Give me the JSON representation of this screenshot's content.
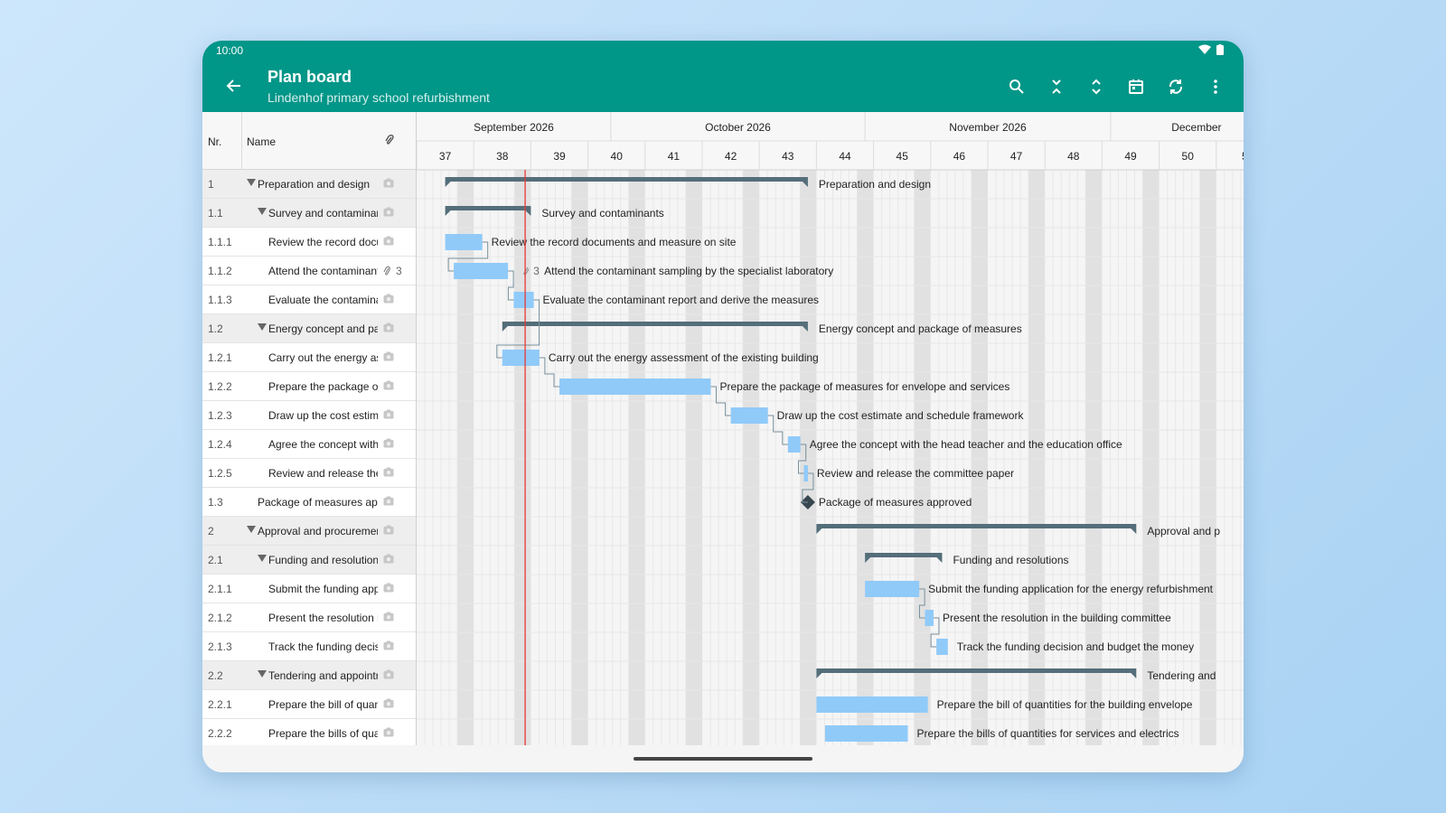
{
  "status": {
    "time": "10:00"
  },
  "app": {
    "title": "Plan board",
    "subtitle": "Lindenhof primary school refurbishment"
  },
  "colors": {
    "accent": "#009688",
    "bar": "#90caf9",
    "summary": "#546e7a",
    "today": "#e53935"
  },
  "table": {
    "header": {
      "nr": "Nr.",
      "name": "Name"
    },
    "rows": [
      {
        "nr": "1",
        "name": "Preparation and design",
        "level": 0,
        "group": true
      },
      {
        "nr": "1.1",
        "name": "Survey and contaminan",
        "level": 1,
        "group": true
      },
      {
        "nr": "1.1.1",
        "name": "Review the record docu",
        "level": 2,
        "group": false
      },
      {
        "nr": "1.1.2",
        "name": "Attend the contaminant",
        "level": 2,
        "group": false,
        "attachments": "3"
      },
      {
        "nr": "1.1.3",
        "name": "Evaluate the contamina",
        "level": 2,
        "group": false
      },
      {
        "nr": "1.2",
        "name": "Energy concept and pa",
        "level": 1,
        "group": true
      },
      {
        "nr": "1.2.1",
        "name": "Carry out the energy as",
        "level": 2,
        "group": false
      },
      {
        "nr": "1.2.2",
        "name": "Prepare the package of",
        "level": 2,
        "group": false
      },
      {
        "nr": "1.2.3",
        "name": "Draw up the cost estim",
        "level": 2,
        "group": false
      },
      {
        "nr": "1.2.4",
        "name": "Agree the concept with",
        "level": 2,
        "group": false
      },
      {
        "nr": "1.2.5",
        "name": "Review and release the",
        "level": 2,
        "group": false
      },
      {
        "nr": "1.3",
        "name": "Package of measures app",
        "level": 1,
        "group": false
      },
      {
        "nr": "2",
        "name": "Approval and procuremer",
        "level": 0,
        "group": true
      },
      {
        "nr": "2.1",
        "name": "Funding and resolutions",
        "level": 1,
        "group": true
      },
      {
        "nr": "2.1.1",
        "name": "Submit the funding app",
        "level": 2,
        "group": false
      },
      {
        "nr": "2.1.2",
        "name": "Present the resolution i",
        "level": 2,
        "group": false
      },
      {
        "nr": "2.1.3",
        "name": "Track the funding decis",
        "level": 2,
        "group": false
      },
      {
        "nr": "2.2",
        "name": "Tendering and appointr",
        "level": 1,
        "group": true
      },
      {
        "nr": "2.2.1",
        "name": "Prepare the bill of quan",
        "level": 2,
        "group": false
      },
      {
        "nr": "2.2.2",
        "name": "Prepare the bills of qua",
        "level": 2,
        "group": false
      }
    ]
  },
  "timeline": {
    "months": [
      "September 2026",
      "October 2026",
      "November 2026",
      "December"
    ],
    "weeks": [
      "37",
      "38",
      "39",
      "40",
      "41",
      "42",
      "43",
      "44",
      "45",
      "46",
      "47",
      "48",
      "49",
      "50",
      "5"
    ],
    "first_week": 37,
    "today_week": 38.9
  },
  "tasks": [
    {
      "type": "summary",
      "start": 37.5,
      "end": 43.85,
      "label": "Preparation and design"
    },
    {
      "type": "summary",
      "start": 37.5,
      "end": 39.0,
      "label": "Survey and contaminants"
    },
    {
      "type": "bar",
      "start": 37.5,
      "end": 38.15,
      "label": "Review the record documents and measure on site"
    },
    {
      "type": "bar",
      "start": 37.65,
      "end": 38.6,
      "label": "Attend the contaminant sampling by the specialist laboratory",
      "attachments": "3"
    },
    {
      "type": "bar",
      "start": 38.7,
      "end": 39.05,
      "label": "Evaluate the contaminant report and derive the measures"
    },
    {
      "type": "summary",
      "start": 38.5,
      "end": 43.85,
      "label": "Energy concept and package of measures"
    },
    {
      "type": "bar",
      "start": 38.5,
      "end": 39.15,
      "label": "Carry out the energy assessment of the existing building"
    },
    {
      "type": "bar",
      "start": 39.5,
      "end": 42.15,
      "label": "Prepare the package of measures for envelope and services"
    },
    {
      "type": "bar",
      "start": 42.5,
      "end": 43.15,
      "label": "Draw up the cost estimate and schedule framework"
    },
    {
      "type": "bar",
      "start": 43.5,
      "end": 43.72,
      "label": "Agree the concept with the head teacher and the education office"
    },
    {
      "type": "bar",
      "start": 43.78,
      "end": 43.85,
      "label": "Review and release the committee paper"
    },
    {
      "type": "milestone",
      "start": 43.85,
      "end": 43.85,
      "label": "Package of measures approved"
    },
    {
      "type": "summary",
      "start": 44.0,
      "end": 49.6,
      "label": "Approval and p"
    },
    {
      "type": "summary",
      "start": 44.85,
      "end": 46.2,
      "label": "Funding and resolutions"
    },
    {
      "type": "bar",
      "start": 44.85,
      "end": 45.8,
      "label": "Submit the funding application for the energy refurbishment"
    },
    {
      "type": "bar",
      "start": 45.9,
      "end": 46.05,
      "label": "Present the resolution in the building committee"
    },
    {
      "type": "bar",
      "start": 46.1,
      "end": 46.3,
      "label": "Track the funding decision and budget the money"
    },
    {
      "type": "summary",
      "start": 44.0,
      "end": 49.6,
      "label": "Tendering and"
    },
    {
      "type": "bar",
      "start": 44.0,
      "end": 45.95,
      "label": "Prepare the bill of quantities for the building envelope"
    },
    {
      "type": "bar",
      "start": 44.15,
      "end": 45.6,
      "label": "Prepare the bills of quantities for services and electrics"
    }
  ],
  "icons": {
    "back": "arrow-left-icon",
    "search": "search-icon",
    "collapse": "collapse-all-icon",
    "expand": "expand-all-icon",
    "calendar": "calendar-icon",
    "sync": "sync-icon",
    "more": "more-vert-icon"
  }
}
